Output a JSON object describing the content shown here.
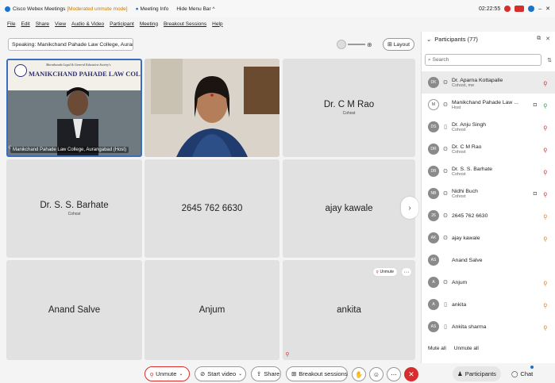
{
  "titlebar": {
    "title": "Cisco Webex Meetings",
    "mode": "[Moderated unmute mode]",
    "meeting_info": "Meeting Info",
    "hide_menu": "Hide Menu Bar",
    "time": "02:22:55",
    "minimize": "–",
    "close": "✕"
  },
  "menu": [
    "File",
    "Edit",
    "Share",
    "View",
    "Audio & Video",
    "Participant",
    "Meeting",
    "Breakout Sessions",
    "Help"
  ],
  "speaking": "Speaking: Manikchand Pahade Law College, Auranga...",
  "layout_label": "Layout",
  "tiles": {
    "t1_banner_sub": "Marathwada Legal & General Education Society's",
    "t1_banner_title": "MANIKCHAND PAHADE LAW COLLEGE",
    "t1_label": "Manikchand Pahade Law College, Aurangabad (Host)",
    "t3_name": "Dr. C M Rao",
    "t3_role": "Cohost",
    "t4_name": "Dr. S. S. Barhate",
    "t4_role": "Cohost",
    "t5_name": "2645 762 6630",
    "t6_name": "ajay kawale",
    "t7_name": "Anand Salve",
    "t8_name": "Anjum",
    "t9_name": "ankita",
    "t9_unmute": "Unmute",
    "t9_more": "···"
  },
  "toolbar": {
    "unmute": "Unmute",
    "start_video": "Start video",
    "share": "Share",
    "breakout": "Breakout sessions"
  },
  "panel": {
    "title": "Participants (77)",
    "search_placeholder": "Search",
    "mute_all": "Mute all",
    "unmute_all": "Unmute all",
    "participants": [
      {
        "initials": "DK",
        "name": "Dr. Aparna Kottapalle",
        "role": "Cohost, me",
        "mic": "muted"
      },
      {
        "initials": "M",
        "name": "Manikchand Pahade Law ...",
        "role": "Host",
        "mic": "active",
        "cam": true,
        "logo": true
      },
      {
        "initials": "DS",
        "name": "Dr. Anju Singh",
        "role": "Cohost",
        "mic": "muted",
        "device": "phone"
      },
      {
        "initials": "DR",
        "name": "Dr. C M Rao",
        "role": "Cohost",
        "mic": "muted"
      },
      {
        "initials": "DB",
        "name": "Dr. S. S. Barhate",
        "role": "Cohost",
        "mic": "muted"
      },
      {
        "initials": "NB",
        "name": "Nidhi Buch",
        "role": "Cohost",
        "mic": "muted",
        "cam": true
      },
      {
        "initials": "26",
        "name": "2645 762 6630",
        "role": "",
        "mic": "orange"
      },
      {
        "initials": "AK",
        "name": "ajay kawale",
        "role": "",
        "mic": "orange"
      },
      {
        "initials": "AS",
        "name": "Anand Salve",
        "role": "",
        "mic": "none",
        "device": "none"
      },
      {
        "initials": "A",
        "name": "Anjum",
        "role": "",
        "mic": "orange"
      },
      {
        "initials": "A",
        "name": "ankita",
        "role": "",
        "mic": "orange",
        "device": "phone"
      },
      {
        "initials": "AS",
        "name": "Ankita sharma",
        "role": "",
        "mic": "orange",
        "device": "phone"
      }
    ]
  },
  "bottom_tabs": {
    "participants": "Participants",
    "chat": "Chat"
  },
  "colors": {
    "accent": "#3a6fbf",
    "mute_red": "#d62d2d",
    "tile_bg": "#e1e1e1"
  }
}
